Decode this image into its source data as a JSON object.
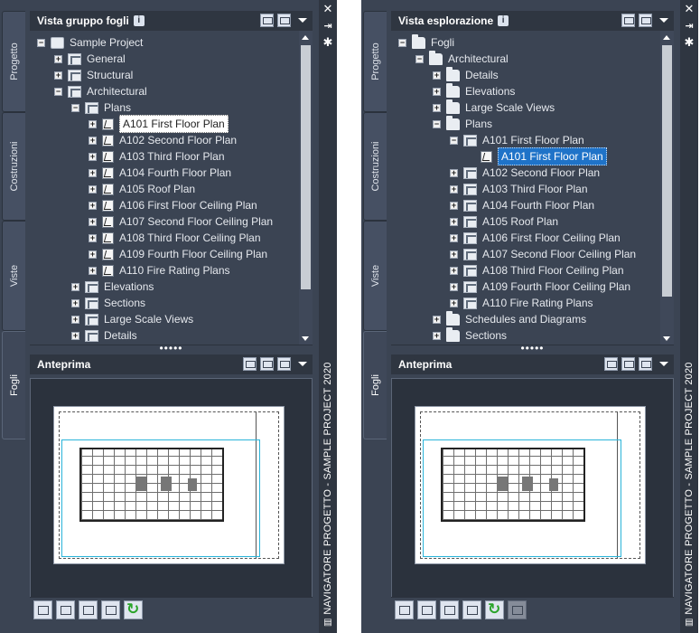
{
  "window_title": "NAVIGATORE PROGETTO - SAMPLE PROJECT 2020",
  "tabs": [
    "Progetto",
    "Costruzioni",
    "Viste",
    "Fogli"
  ],
  "active_tab": "Fogli",
  "left": {
    "section_title": "Vista gruppo fogli",
    "info": "i",
    "preview_title": "Anteprima",
    "tree": [
      {
        "label": "Sample Project",
        "icon": "project-icon",
        "expander": "−",
        "level": 0
      },
      {
        "label": "General",
        "icon": "sheet-set-icon",
        "expander": "+",
        "level": 1
      },
      {
        "label": "Structural",
        "icon": "sheet-set-icon",
        "expander": "+",
        "level": 1
      },
      {
        "label": "Architectural",
        "icon": "sheet-set-icon",
        "expander": "−",
        "level": 1
      },
      {
        "label": "Plans",
        "icon": "sheet-set-icon",
        "expander": "−",
        "level": 2
      },
      {
        "label": "A101 First Floor Plan",
        "icon": "sheet-icon",
        "expander": "+",
        "level": 3,
        "selected": true
      },
      {
        "label": "A102 Second Floor Plan",
        "icon": "sheet-icon",
        "expander": "+",
        "level": 3
      },
      {
        "label": "A103 Third Floor Plan",
        "icon": "sheet-icon",
        "expander": "+",
        "level": 3
      },
      {
        "label": "A104 Fourth Floor Plan",
        "icon": "sheet-icon",
        "expander": "+",
        "level": 3
      },
      {
        "label": "A105 Roof Plan",
        "icon": "sheet-icon",
        "expander": "+",
        "level": 3
      },
      {
        "label": "A106 First Floor Ceiling Plan",
        "icon": "sheet-icon",
        "expander": "+",
        "level": 3
      },
      {
        "label": "A107 Second Floor Ceiling Plan",
        "icon": "sheet-icon",
        "expander": "+",
        "level": 3
      },
      {
        "label": "A108 Third Floor Ceiling Plan",
        "icon": "sheet-icon",
        "expander": "+",
        "level": 3
      },
      {
        "label": "A109 Fourth Floor Ceiling Plan",
        "icon": "sheet-icon",
        "expander": "+",
        "level": 3
      },
      {
        "label": "A110 Fire Rating Plans",
        "icon": "sheet-icon",
        "expander": "+",
        "level": 3
      },
      {
        "label": "Elevations",
        "icon": "sheet-set-icon",
        "expander": "+",
        "level": 2
      },
      {
        "label": "Sections",
        "icon": "sheet-set-icon",
        "expander": "+",
        "level": 2
      },
      {
        "label": "Large Scale Views",
        "icon": "sheet-set-icon",
        "expander": "+",
        "level": 2
      },
      {
        "label": "Details",
        "icon": "sheet-set-icon",
        "expander": "+",
        "level": 2
      }
    ]
  },
  "right": {
    "section_title": "Vista esplorazione",
    "info": "i",
    "preview_title": "Anteprima",
    "tree": [
      {
        "label": "Fogli",
        "icon": "folder-icon",
        "expander": "−",
        "level": 0
      },
      {
        "label": "Architectural",
        "icon": "folder-icon",
        "expander": "−",
        "level": 1
      },
      {
        "label": "Details",
        "icon": "folder-icon",
        "expander": "+",
        "level": 2
      },
      {
        "label": "Elevations",
        "icon": "folder-icon",
        "expander": "+",
        "level": 2
      },
      {
        "label": "Large Scale Views",
        "icon": "folder-icon",
        "expander": "+",
        "level": 2
      },
      {
        "label": "Plans",
        "icon": "folder-icon",
        "expander": "−",
        "level": 2
      },
      {
        "label": "A101 First Floor Plan",
        "icon": "sheet-stack-icon",
        "expander": "−",
        "level": 3
      },
      {
        "label": "A101 First Floor Plan",
        "icon": "sheet-icon",
        "expander": "",
        "level": 4,
        "selected": true
      },
      {
        "label": "A102 Second Floor Plan",
        "icon": "sheet-stack-icon",
        "expander": "+",
        "level": 3
      },
      {
        "label": "A103 Third Floor Plan",
        "icon": "sheet-stack-icon",
        "expander": "+",
        "level": 3
      },
      {
        "label": "A104 Fourth Floor Plan",
        "icon": "sheet-stack-icon",
        "expander": "+",
        "level": 3
      },
      {
        "label": "A105 Roof Plan",
        "icon": "sheet-stack-icon",
        "expander": "+",
        "level": 3
      },
      {
        "label": "A106 First Floor Ceiling Plan",
        "icon": "sheet-stack-icon",
        "expander": "+",
        "level": 3
      },
      {
        "label": "A107 Second Floor Ceiling Plan",
        "icon": "sheet-stack-icon",
        "expander": "+",
        "level": 3
      },
      {
        "label": "A108 Third Floor Ceiling Plan",
        "icon": "sheet-stack-icon",
        "expander": "+",
        "level": 3
      },
      {
        "label": "A109 Fourth Floor Ceiling Plan",
        "icon": "sheet-stack-icon",
        "expander": "+",
        "level": 3
      },
      {
        "label": "A110 Fire Rating Plans",
        "icon": "sheet-stack-icon",
        "expander": "+",
        "level": 3
      },
      {
        "label": "Schedules and Diagrams",
        "icon": "folder-icon",
        "expander": "+",
        "level": 2
      },
      {
        "label": "Sections",
        "icon": "folder-icon",
        "expander": "+",
        "level": 2
      }
    ]
  },
  "close_glyph": "✕",
  "pin_glyph": "⇥",
  "settings_glyph": "✱",
  "grip_glyph": "•••••"
}
